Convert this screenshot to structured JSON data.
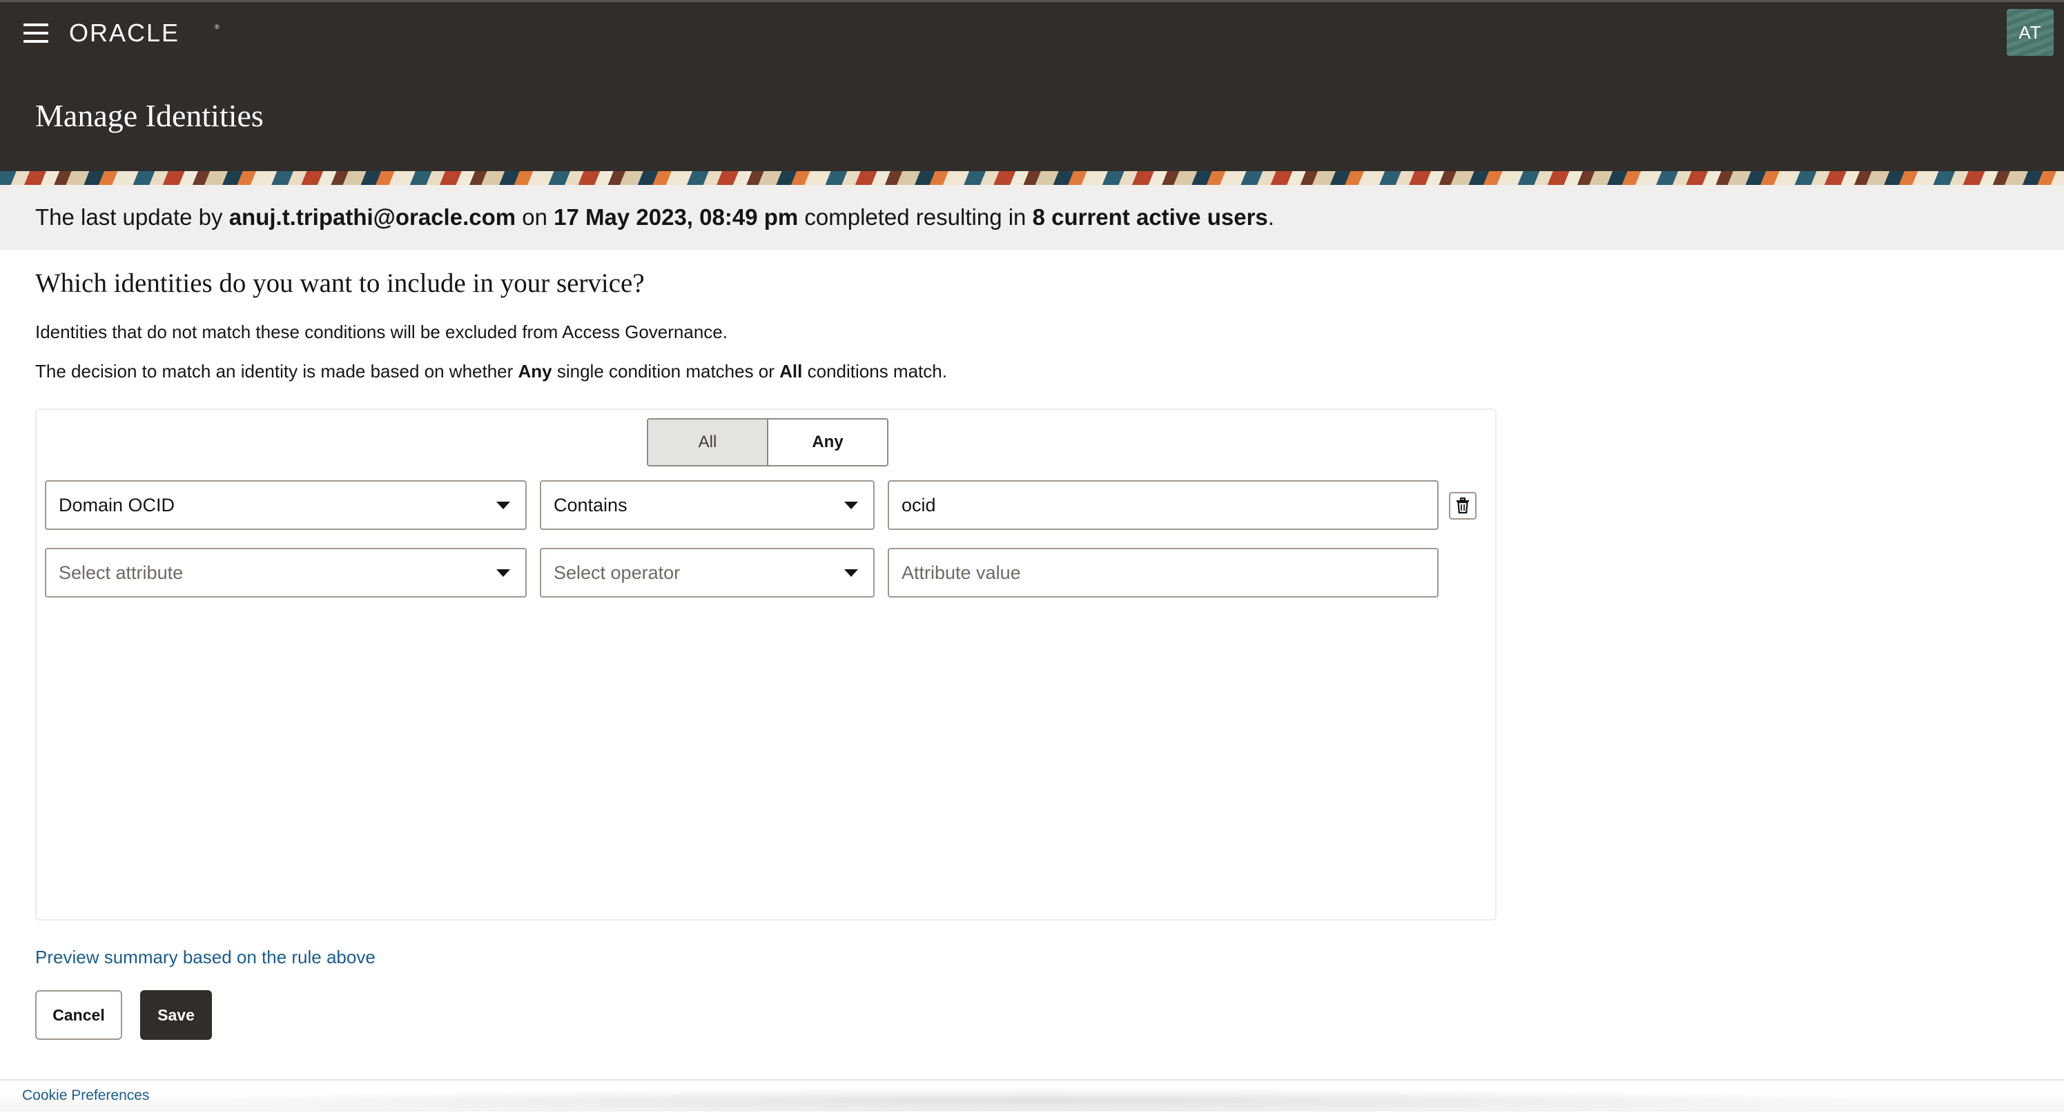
{
  "header": {
    "brand": "ORACLE",
    "page_title": "Manage Identities",
    "avatar_initials": "AT"
  },
  "banner": {
    "prefix": "The last update by ",
    "user": "anuj.t.tripathi@oracle.com",
    "on": " on ",
    "datetime": "17 May 2023, 08:49 pm",
    "middle": " completed resulting in ",
    "count": "8 current active users",
    "suffix": "."
  },
  "main": {
    "question": "Which identities do you want to include in your service?",
    "description1": "Identities that do not match these conditions will be excluded from Access Governance.",
    "description2": {
      "part1": "The decision to match an identity is made based on whether ",
      "any": "Any",
      "part2": " single condition matches or ",
      "all": "All",
      "part3": " conditions match."
    },
    "match_toggle": {
      "options": [
        "All",
        "Any"
      ],
      "selected": "Any"
    },
    "conditions": [
      {
        "attribute": "Domain OCID",
        "operator": "Contains",
        "value": "ocid"
      },
      {
        "attribute_placeholder": "Select attribute",
        "operator_placeholder": "Select operator",
        "value_placeholder": "Attribute value"
      }
    ],
    "preview_link": "Preview summary based on the rule above",
    "cancel_label": "Cancel",
    "save_label": "Save"
  },
  "footer": {
    "cookie_link": "Cookie Preferences"
  },
  "colors": {
    "header_bg": "#312d2a",
    "banner_bg": "#f1efed",
    "link": "#1b5c8c",
    "primary_button": "#312d2a",
    "avatar_bg": "#4d7a72"
  },
  "icons": [
    "hamburger-menu-icon",
    "oracle-logo",
    "chevron-down-icon",
    "trash-icon"
  ]
}
